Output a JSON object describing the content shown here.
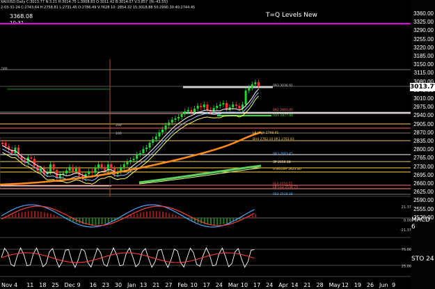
{
  "header": {
    "info_line": "XAUUSD Daily  C:3013.77  N:3.21  H:3014.75  L:3008.83  O:3011.42  B:3014.07  V:3,857  {N:-43.55}",
    "ohlc_line": "2-03-31-24  C:2743.64  H:2758.81  L:2731.45  O:2786.49  V:7628  10:  2854.32  15:3018.88  50:2990.30  40:2744.45"
  },
  "corner": {
    "value": "3368.08",
    "sub": "10-31"
  },
  "chart_title": "T=Q Levels New",
  "price_axis": {
    "ticks": [
      "3360.00",
      "3325.00",
      "3290.00",
      "3255.00",
      "3220.00",
      "3185.00",
      "3150.00",
      "3115.00",
      "3080.00",
      "3045.00",
      "3010.00",
      "2975.00",
      "2940.00",
      "2905.00",
      "2870.00",
      "2835.00",
      "2800.00",
      "2765.00",
      "2730.00",
      "2695.00",
      "2660.00",
      "2625.00",
      "2590.00",
      "2555.00",
      "2520.00"
    ],
    "current_price": "3013.77"
  },
  "levels": [
    {
      "text": "0R3  3036.91",
      "color": "#c8c8c8"
    },
    {
      "text": "0R2  2893.40",
      "color": "#ff6b6b"
    },
    {
      "text": "0HS  2877.86",
      "color": "#33dd33"
    },
    {
      "text": "LB High  2798.91",
      "color": "#ffd24a"
    },
    {
      "text": "BH4  2762.10  0R1  2763.83",
      "color": "#ffd24a"
    },
    {
      "text": "0R3  2683.45",
      "color": "#66b3ff"
    },
    {
      "text": "3P  2650.18",
      "color": "#ffffff"
    },
    {
      "text": "0.9xOver  2623.80",
      "color": "#ffd24a"
    },
    {
      "text": "0L3  2554.15",
      "color": "#ff5555"
    },
    {
      "text": "LB Low  2538.73",
      "color": "#ff5555"
    },
    {
      "text": "0S3  2518.38",
      "color": "#66b3ff"
    }
  ],
  "chart_labels": {
    "top_left": "500",
    "mid_a": "200",
    "mid_b": "100"
  },
  "indicators": {
    "macd_label": "MACD 6",
    "macd_values": [
      "21.37",
      "0.00",
      "-21.37"
    ],
    "sto_label": "STO 24",
    "sto_values": [
      "75.00",
      "25.00"
    ]
  },
  "date_axis": [
    "Nov",
    "4",
    "11",
    "18",
    "25",
    "Dec",
    "9",
    "16",
    "23",
    "30",
    "Jan",
    "13",
    "21",
    "27",
    "Feb",
    "10",
    "17",
    "24",
    "Mar",
    "10",
    "17",
    "24",
    "Apr",
    "14",
    "21",
    "28",
    "May",
    "12",
    "19",
    "26",
    "Jun",
    "9"
  ],
  "colors": {
    "bg": "#000000",
    "up": "#22d633",
    "down": "#ff3030",
    "magenta": "#e000e0"
  }
}
